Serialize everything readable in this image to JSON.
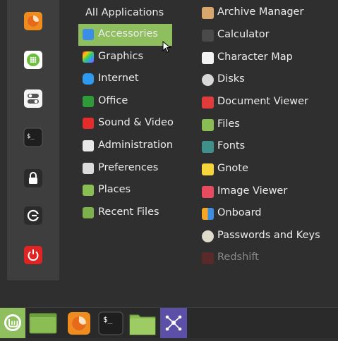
{
  "favorites": [
    {
      "name": "firefox",
      "icon": "firefox-icon"
    },
    {
      "name": "software-manager",
      "icon": "software-manager-icon"
    },
    {
      "name": "system-settings",
      "icon": "settings-toggle-icon"
    },
    {
      "name": "terminal",
      "icon": "terminal-icon",
      "text": "$_"
    },
    {
      "name": "lock-screen",
      "icon": "lock-icon"
    },
    {
      "name": "logout",
      "icon": "logout-icon"
    },
    {
      "name": "shutdown",
      "icon": "power-icon"
    }
  ],
  "categories": {
    "header": "All Applications",
    "items": [
      {
        "label": "Accessories",
        "selected": true
      },
      {
        "label": "Graphics"
      },
      {
        "label": "Internet"
      },
      {
        "label": "Office"
      },
      {
        "label": "Sound & Video"
      },
      {
        "label": "Administration"
      },
      {
        "label": "Preferences"
      },
      {
        "label": "Places"
      },
      {
        "label": "Recent Files"
      }
    ]
  },
  "apps": [
    {
      "label": "Archive Manager"
    },
    {
      "label": "Calculator"
    },
    {
      "label": "Character Map"
    },
    {
      "label": "Disks"
    },
    {
      "label": "Document Viewer"
    },
    {
      "label": "Files"
    },
    {
      "label": "Fonts"
    },
    {
      "label": "Gnote"
    },
    {
      "label": "Image Viewer"
    },
    {
      "label": "Onboard"
    },
    {
      "label": "Passwords and Keys"
    },
    {
      "label": "Redshift"
    }
  ],
  "panel": {
    "items": [
      "menu-button",
      "show-desktop",
      "firefox",
      "terminal",
      "files",
      "network-app"
    ],
    "terminal_text": "$_"
  },
  "colors": {
    "accent": "#8fbe5f",
    "background": "#2f2f2f",
    "favorites_bar": "#3e3e3e",
    "panel": "#2a2a2a"
  }
}
